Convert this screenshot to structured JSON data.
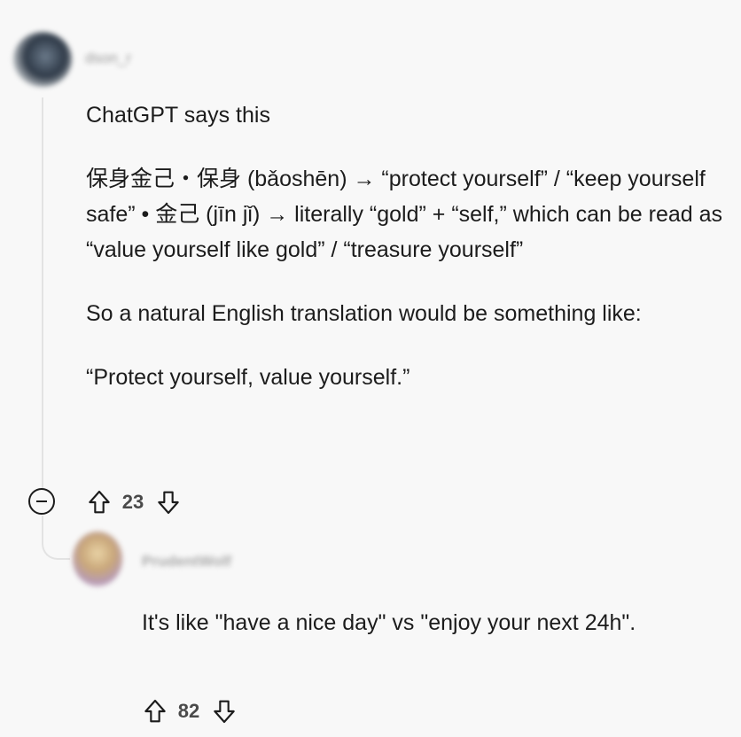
{
  "comments": [
    {
      "author": "dson_r",
      "paragraphs": [
        "ChatGPT says this",
        "保身金己・保身 (bǎoshēn) → “protect yourself” / “keep yourself safe” • 金己 (jīn jǐ) → literally “gold” + “self,” which can be read as “value yourself like gold” / “treasure yourself”",
        "So a natural English translation would be something like:",
        "“Protect yourself, value yourself.”"
      ],
      "score": "23"
    },
    {
      "author": "PrudentWolf",
      "paragraphs": [
        "It's like \"have a nice day\" vs \"enjoy your next 24h\"."
      ],
      "score": "82"
    }
  ],
  "icons": {
    "upvote": "arrow-up-outline",
    "downvote": "arrow-down-outline",
    "collapse": "minus-circle"
  },
  "colors": {
    "text": "#1c1c1c",
    "meta": "#4a4a4a",
    "thread": "#e3e3e3",
    "background": "#f8f8f8"
  }
}
